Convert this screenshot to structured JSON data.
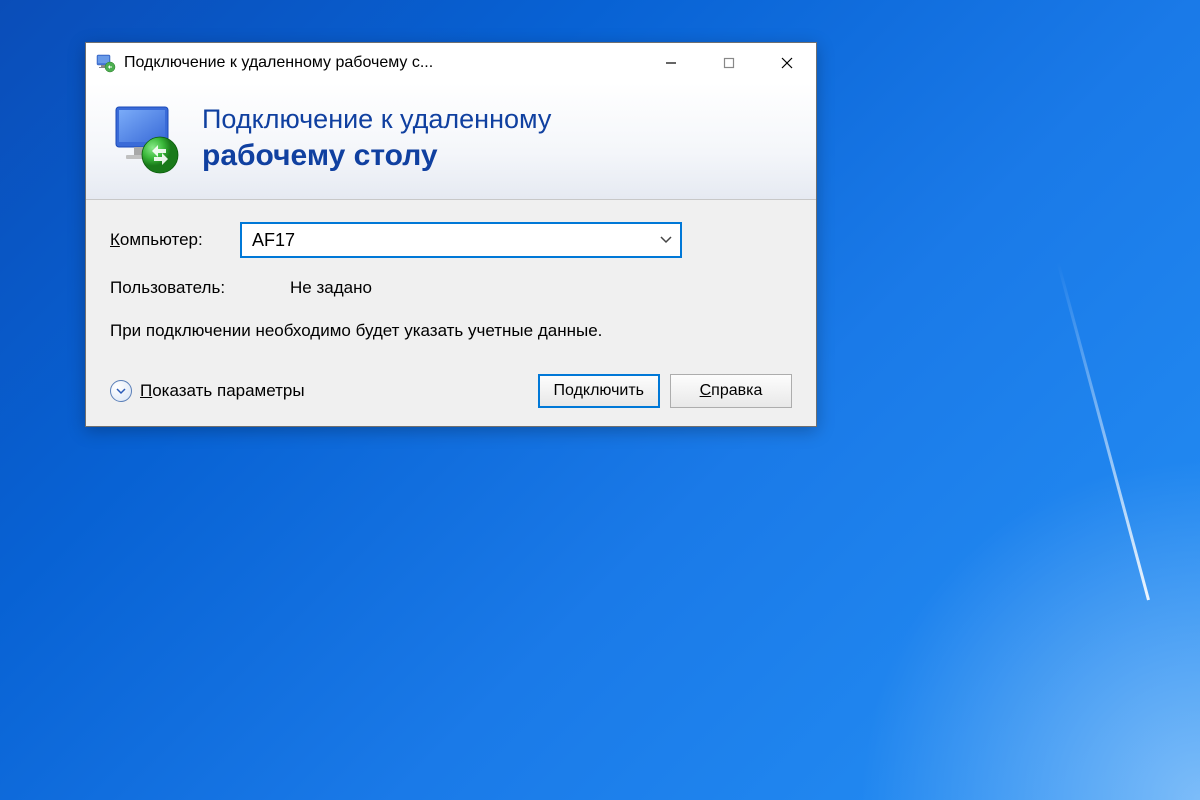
{
  "titlebar": {
    "title": "Подключение к удаленному рабочему с..."
  },
  "header": {
    "line1": "Подключение к удаленному",
    "line2": "рабочему столу"
  },
  "form": {
    "computer_label_prefix": "К",
    "computer_label_rest": "омпьютер:",
    "computer_value": "AF17",
    "user_label": "Пользователь:",
    "user_value": "Не задано",
    "info_text": "При подключении необходимо будет указать учетные данные."
  },
  "footer": {
    "show_options_prefix": "П",
    "show_options_rest": "оказать параметры",
    "connect_label": "Подключить",
    "help_prefix": "С",
    "help_rest": "правка"
  }
}
